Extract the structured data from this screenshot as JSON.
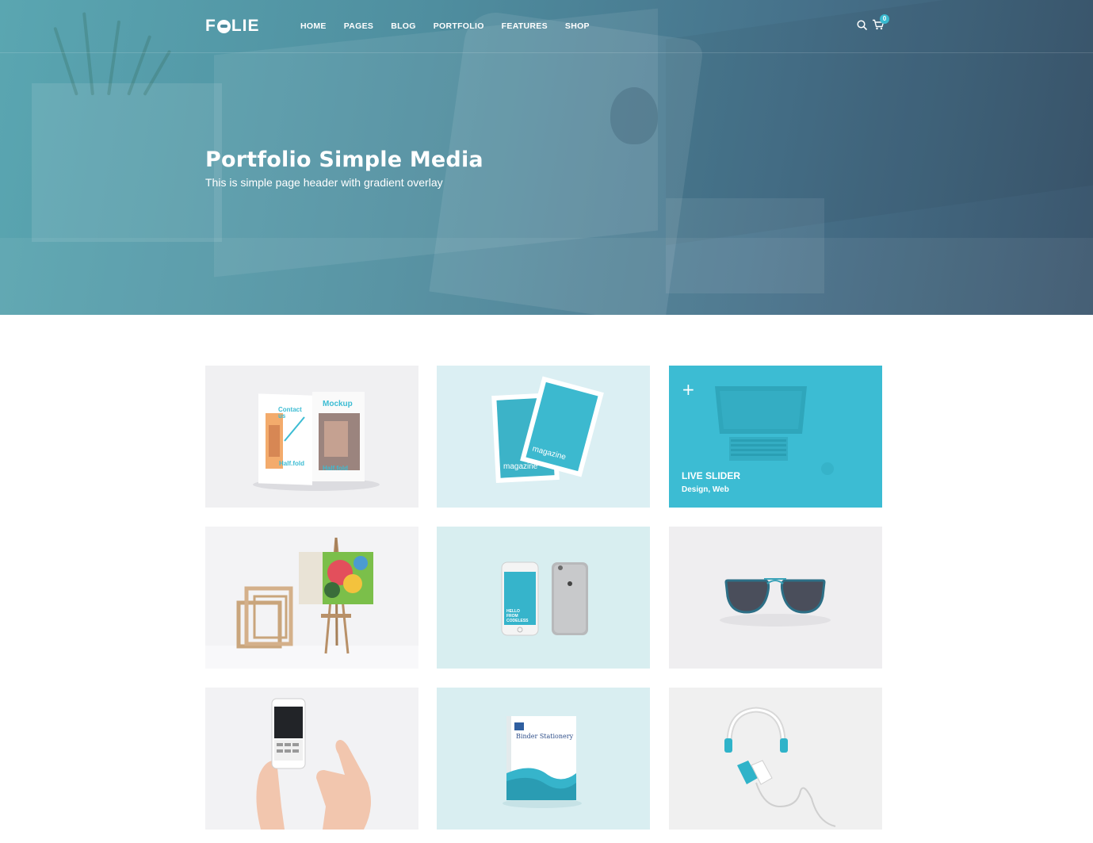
{
  "header": {
    "logo": "FOLIE",
    "nav": [
      "HOME",
      "PAGES",
      "BLOG",
      "PORTFOLIO",
      "FEATURES",
      "SHOP"
    ],
    "cart_count": "0"
  },
  "hero": {
    "title": "Portfolio Simple Media",
    "subtitle": "This is simple page header with gradient overlay"
  },
  "portfolio": {
    "items": [
      {
        "image": "half-fold brochure mockup",
        "mock_texts": [
          "Contact us",
          "Mockup",
          "Half.fold",
          "Half.fold"
        ]
      },
      {
        "image": "magazine cover mockup",
        "mock_texts": [
          "magazine",
          "magazine"
        ]
      },
      {
        "image": "laptop mockup",
        "title": "LIVE SLIDER",
        "categories": "Design, Web",
        "hovered": true
      },
      {
        "image": "painting on easel"
      },
      {
        "image": "iphone front and back",
        "mock_texts": [
          "HELLO",
          "FROM",
          "CODELESS"
        ]
      },
      {
        "image": "sunglasses"
      },
      {
        "image": "hands holding phone"
      },
      {
        "image": "binder stationery mockup",
        "mock_texts": [
          "Binder Stationery"
        ]
      },
      {
        "image": "headphones"
      }
    ]
  },
  "colors": {
    "accent": "#3cbcd3",
    "hero_gradient_start": "#5aa6b1",
    "hero_gradient_end": "#3b566d"
  }
}
